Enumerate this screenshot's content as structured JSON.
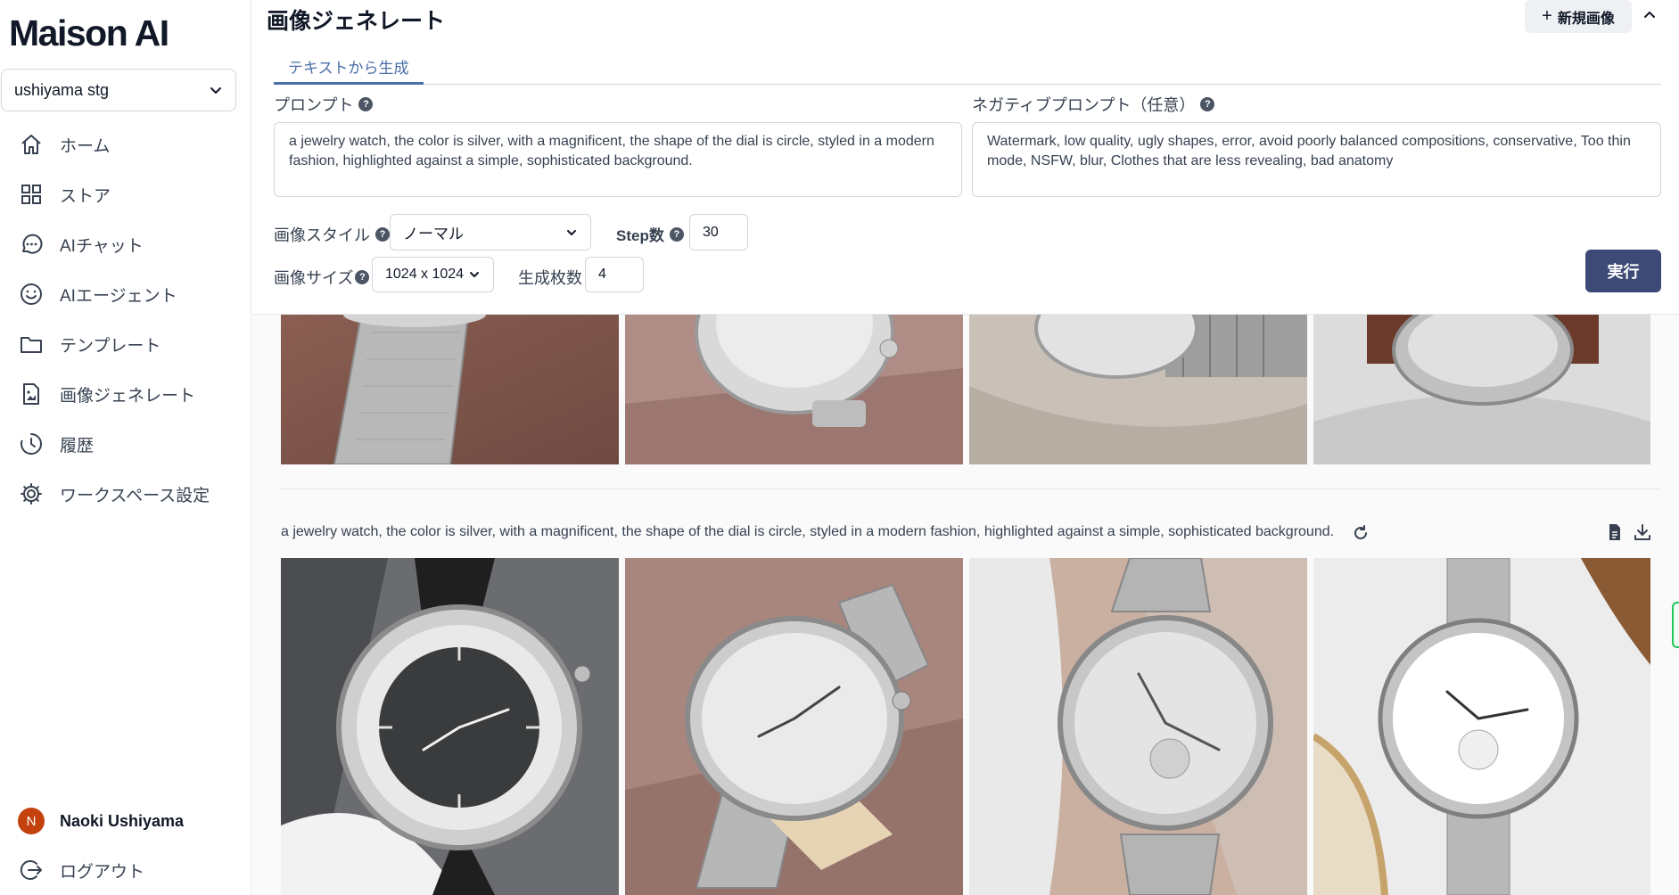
{
  "app": {
    "brand": "Maison AI"
  },
  "sidebar": {
    "workspace": "ushiyama stg",
    "items": [
      {
        "label": "ホーム",
        "icon": "home-icon"
      },
      {
        "label": "ストア",
        "icon": "grid-icon"
      },
      {
        "label": "AIチャット",
        "icon": "chat-icon"
      },
      {
        "label": "AIエージェント",
        "icon": "smile-icon"
      },
      {
        "label": "テンプレート",
        "icon": "folder-icon"
      },
      {
        "label": "画像ジェネレート",
        "icon": "image-file-icon"
      },
      {
        "label": "履歴",
        "icon": "history-icon"
      },
      {
        "label": "ワークスペース設定",
        "icon": "gear-icon"
      }
    ],
    "user": {
      "initial": "N",
      "name": "Naoki Ushiyama"
    },
    "logout": "ログアウト"
  },
  "header": {
    "title": "画像ジェネレート",
    "new_button": "新規画像",
    "new_button_icon": "+"
  },
  "tabs": [
    {
      "label": "テキストから生成",
      "active": true
    }
  ],
  "form": {
    "prompt_label": "プロンプト",
    "prompt_value": "a jewelry watch, the color is silver, with a magnificent, the shape of the dial is circle, styled in a modern fashion, highlighted against a simple, sophisticated background.",
    "negative_label": "ネガティブプロンプト（任意）",
    "negative_value": "Watermark, low quality, ugly shapes, error, avoid poorly balanced compositions, conservative, Too thin mode, NSFW, blur, Clothes that are less revealing, bad anatomy",
    "style_label": "画像スタイル",
    "style_value": "ノーマル",
    "steps_label": "Step数",
    "steps_value": "30",
    "size_label": "画像サイズ",
    "size_value": "1024 x 1024",
    "count_label": "生成枚数",
    "count_value": "4",
    "help_glyph": "?",
    "run_button": "実行"
  },
  "results": {
    "prompt": "a jewelry watch, the color is silver, with a magnificent, the shape of the dial is circle, styled in a modern fashion, highlighted against a simple, sophisticated background."
  },
  "colors": {
    "accent": "#3d4a75",
    "tab_active": "#4b6ea8",
    "avatar": "#c2410c"
  }
}
